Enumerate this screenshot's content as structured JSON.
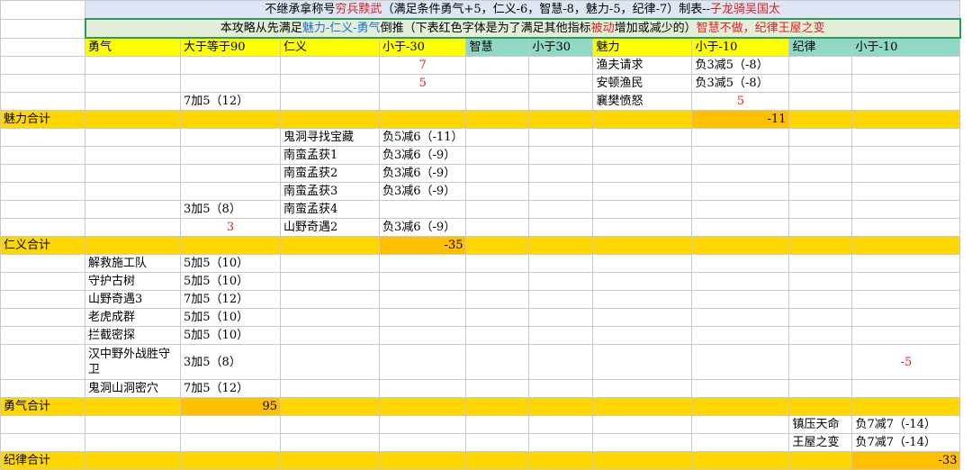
{
  "title_row1": {
    "pre": "不继承拿称号",
    "highlight": "穷兵黩武",
    "post": "（满足条件勇气+5，仁义-6，智慧-8，魅力-5，纪律-7）制表--",
    "author": "子龙骑吴国太"
  },
  "title_row2": {
    "pre": "本攻略从先满足",
    "order": "魅力-仁义-勇气",
    "mid1": "倒推（下表红色字体是为了满足其他指标",
    "passive": "被动",
    "mid2": "增加或减少的）",
    "tail": "智慧不做，纪律王屋之变"
  },
  "headers": [
    "勇气",
    "大于等于90",
    "仁义",
    "小于-30",
    "智慧",
    "小于30",
    "魅力",
    "小于-10",
    "纪律",
    "小于-10"
  ],
  "rows": {
    "r3": {
      "rj_val": "7",
      "ml": "渔夫请求",
      "ml_val": "负3减5（-8）"
    },
    "r4": {
      "rj_val": "5",
      "ml": "安顿渔民",
      "ml_val": "负3减5（-8）"
    },
    "r5": {
      "yq_val": "7加5（12）",
      "ml": "襄樊愤怒",
      "ml_val": "5"
    },
    "r6": {
      "label": "魅力合计",
      "total": "-11"
    },
    "r7": {
      "rj": "鬼洞寻找宝藏",
      "rj_val": "负5减6（-11）"
    },
    "r8": {
      "rj": "南蛮孟获1",
      "rj_val": "负3减6（-9）"
    },
    "r9": {
      "rj": "南蛮孟获2",
      "rj_val": "负3减6（-9）"
    },
    "r10": {
      "rj": "南蛮孟获3",
      "rj_val": "负3减6（-9）"
    },
    "r11": {
      "yq_val": "3加5（8）",
      "rj": "南蛮孟获4"
    },
    "r12": {
      "yq_val": "3",
      "rj": "山野奇遇2",
      "rj_val": "负3减6（-9）"
    },
    "r13": {
      "label": "仁义合计",
      "total": "-35"
    },
    "r14": {
      "yq": "解救施工队",
      "yq_val": "5加5（10）"
    },
    "r15": {
      "yq": "守护古树",
      "yq_val": "5加5（10）"
    },
    "r16": {
      "yq": "山野奇遇3",
      "yq_val": "7加5（12）"
    },
    "r17": {
      "yq": "老虎成群",
      "yq_val": "5加5（10）"
    },
    "r18": {
      "yq": "拦截密探",
      "yq_val": "5加5（10）"
    },
    "r19": {
      "yq": "汉中野外战胜守卫",
      "yq_val": "3加5（8）",
      "jl_val": "-5"
    },
    "r20": {
      "yq": "鬼洞山洞密穴",
      "yq_val": "7加5（12）"
    },
    "r21": {
      "label": "勇气合计",
      "total": "95"
    },
    "r22": {
      "jl": "镇压天命",
      "jl_val": "负7减7（-14）"
    },
    "r23": {
      "jl": "王屋之变",
      "jl_val": "负7减7（-14）"
    },
    "r24": {
      "label": "纪律合计",
      "total": "-33"
    }
  }
}
